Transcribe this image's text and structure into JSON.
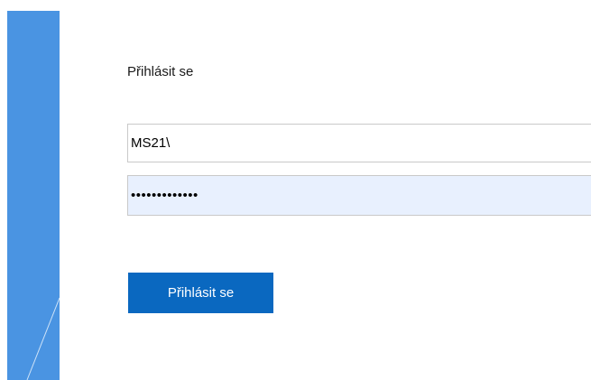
{
  "colors": {
    "accent_panel": "#4a94e2",
    "button_bg": "#0a68c0",
    "button_text": "#ffffff",
    "password_autofill_bg": "#e8f0fe",
    "field_border": "#c9c9c9"
  },
  "login": {
    "title": "Přihlásit se",
    "username_value": "MS21\\",
    "password_value": "•••••••••••••",
    "submit_label": "Přihlásit se"
  }
}
